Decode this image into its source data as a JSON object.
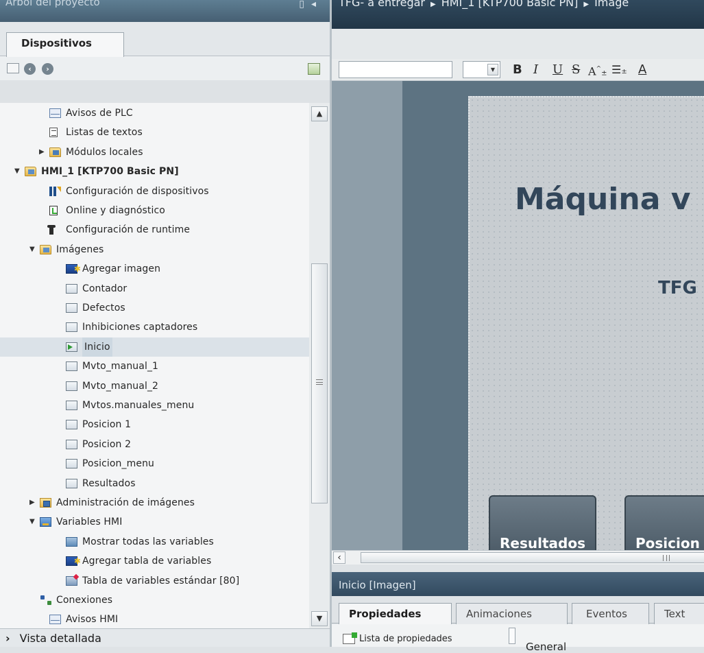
{
  "left_panel": {
    "title": "Árbol del proyecto",
    "tab_label": "Dispositivos",
    "bottom_bar_label": "Vista detallada",
    "tree": [
      {
        "label": "Avisos de PLC",
        "icon": "mail-icon"
      },
      {
        "label": "Listas de textos",
        "icon": "text-list-icon"
      },
      {
        "label": "Módulos locales",
        "icon": "folder-icon",
        "expander": "collapsed"
      },
      {
        "label": "HMI_1 [KTP700 Basic PN]",
        "icon": "folder-icon",
        "expander": "expanded"
      },
      {
        "label": "Configuración de dispositivos",
        "icon": "device-config-icon"
      },
      {
        "label": "Online y diagnóstico",
        "icon": "diagnostics-icon"
      },
      {
        "label": "Configuración de runtime",
        "icon": "runtime-config-icon"
      },
      {
        "label": "Imágenes",
        "icon": "folder-icon",
        "expander": "expanded"
      },
      {
        "label": "Agregar imagen",
        "icon": "add-screen-icon"
      },
      {
        "label": "Contador",
        "icon": "screen-icon"
      },
      {
        "label": "Defectos",
        "icon": "screen-icon"
      },
      {
        "label": "Inhibiciones captadores",
        "icon": "screen-icon"
      },
      {
        "label": "Inicio",
        "icon": "start-screen-icon",
        "selected": true
      },
      {
        "label": "Mvto_manual_1",
        "icon": "screen-icon"
      },
      {
        "label": "Mvto_manual_2",
        "icon": "screen-icon"
      },
      {
        "label": "Mvtos.manuales_menu",
        "icon": "screen-icon"
      },
      {
        "label": "Posicion 1",
        "icon": "screen-icon"
      },
      {
        "label": "Posicion 2",
        "icon": "screen-icon"
      },
      {
        "label": "Posicion_menu",
        "icon": "screen-icon"
      },
      {
        "label": "Resultados",
        "icon": "screen-icon"
      },
      {
        "label": "Administración de imágenes",
        "icon": "screen-admin-folder-icon",
        "expander": "collapsed"
      },
      {
        "label": "Variables HMI",
        "icon": "hmi-variables-folder-icon",
        "expander": "expanded"
      },
      {
        "label": "Mostrar todas las variables",
        "icon": "show-variables-icon"
      },
      {
        "label": "Agregar tabla de variables",
        "icon": "add-table-icon"
      },
      {
        "label": "Tabla de variables estándar [80]",
        "icon": "variable-table-icon"
      },
      {
        "label": "Conexiones",
        "icon": "connections-icon"
      },
      {
        "label": "Avisos HMI",
        "icon": "mail-icon"
      }
    ]
  },
  "editor": {
    "breadcrumb": [
      "TFG- a entregar",
      "HMI_1 [KTP700 Basic PN]",
      "Imáge"
    ],
    "format_buttons": {
      "bold": "B",
      "italic": "I",
      "underline": "U",
      "strike": "S",
      "size_up": "A",
      "font_color": "A"
    },
    "screen": {
      "title": "Máquina v",
      "subtitle": "TFG",
      "buttons": [
        "Resultados",
        "Posicion"
      ]
    }
  },
  "inspector": {
    "header": "Inicio [Imagen]",
    "tabs": [
      "Propiedades",
      "Animaciones",
      "Eventos",
      "Text"
    ],
    "property_list_label": "Lista de propiedades",
    "section_label": "General"
  },
  "colors": {
    "header_dark": "#2c4357",
    "canvas_bg": "#5d7382",
    "screen_text": "#32465a"
  }
}
